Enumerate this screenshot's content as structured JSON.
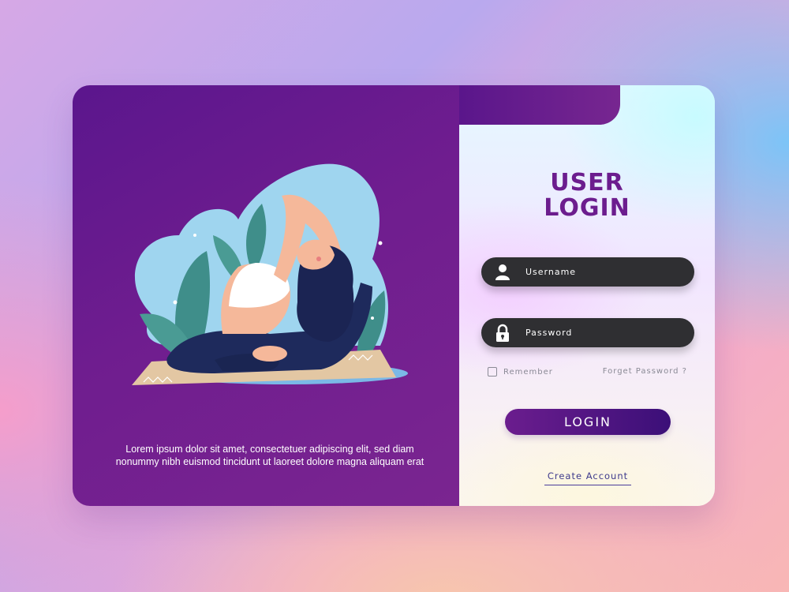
{
  "illustration": {
    "subject": "woman doing a yoga pose on a mat"
  },
  "left_panel": {
    "description": "Lorem ipsum dolor sit amet, consectetuer adipiscing elit, sed diam nonummy nibh euismod tincidunt ut laoreet dolore magna aliquam erat"
  },
  "login": {
    "title_line1": "USER",
    "title_line2": "LOGIN",
    "username_placeholder": "Username",
    "password_placeholder": "Password",
    "remember_label": "Remember",
    "forgot_label": "Forget Password ?",
    "login_button": "LOGIN",
    "create_account": "Create Account"
  },
  "icons": {
    "username": "user-icon",
    "password": "lock-icon"
  },
  "colors": {
    "primary_purple": "#6c1d8e",
    "dark_field": "#2f2f32",
    "button_gradient_end": "#3b0f78",
    "link_color": "#3e3a8c"
  }
}
